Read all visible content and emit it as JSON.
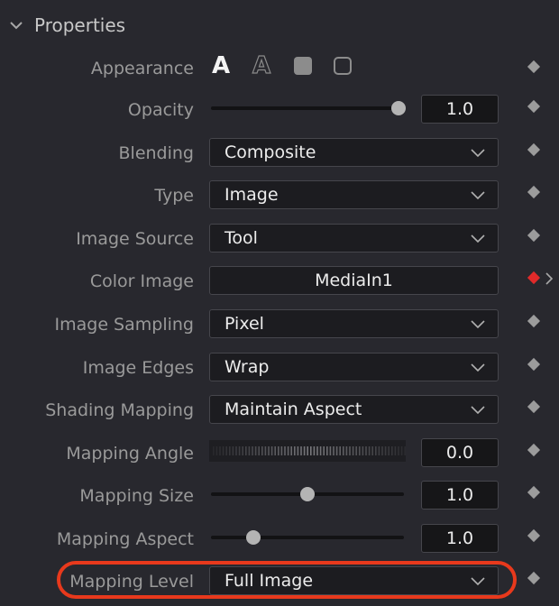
{
  "section": {
    "title": "Properties",
    "icon": "chevron-down-icon"
  },
  "appearance": {
    "label": "Appearance",
    "icons": [
      "text-solid-icon",
      "text-outline-icon",
      "rounded-square-filled-icon",
      "rounded-square-outline-icon"
    ]
  },
  "opacity": {
    "label": "Opacity",
    "value": "1.0",
    "level": 1.0
  },
  "blending": {
    "label": "Blending",
    "value": "Composite"
  },
  "type": {
    "label": "Type",
    "value": "Image"
  },
  "image_source": {
    "label": "Image Source",
    "value": "Tool"
  },
  "color_image": {
    "label": "Color Image",
    "value": "MediaIn1"
  },
  "image_sampling": {
    "label": "Image Sampling",
    "value": "Pixel"
  },
  "image_edges": {
    "label": "Image Edges",
    "value": "Wrap"
  },
  "shading_mapping": {
    "label": "Shading Mapping",
    "value": "Maintain Aspect"
  },
  "mapping_angle": {
    "label": "Mapping Angle",
    "value": "0.0"
  },
  "mapping_size": {
    "label": "Mapping Size",
    "value": "1.0",
    "level": 0.5
  },
  "mapping_aspect": {
    "label": "Mapping Aspect",
    "value": "1.0",
    "level": 0.22
  },
  "mapping_level": {
    "label": "Mapping Level",
    "value": "Full Image"
  },
  "colors": {
    "background": "#28282e",
    "field": "#1c1c20",
    "highlight": "#e8391c",
    "keyframe_active": "#e02a2a"
  }
}
